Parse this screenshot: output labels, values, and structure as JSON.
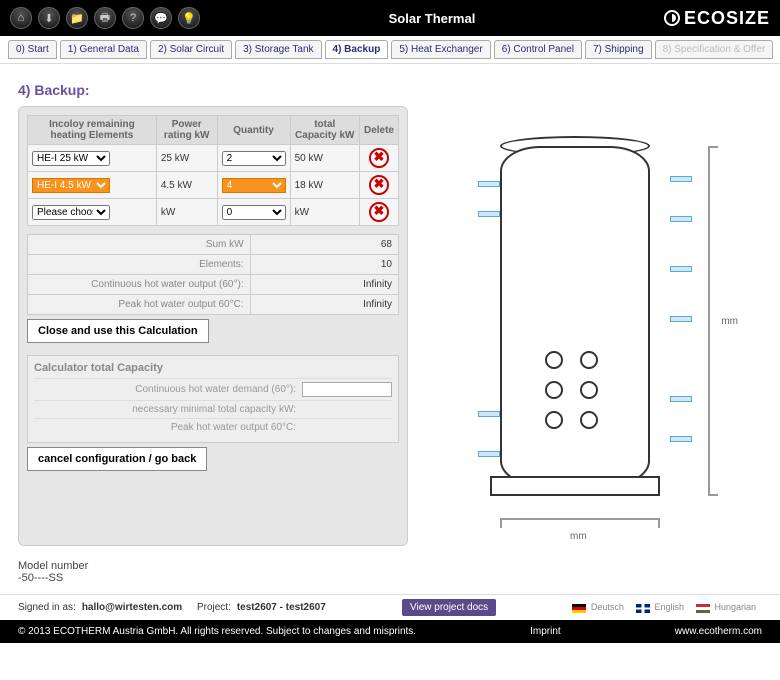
{
  "topbar": {
    "title": "Solar Thermal",
    "brand": "ECOSIZE"
  },
  "icons": [
    "home",
    "download",
    "folder",
    "print",
    "help",
    "chat",
    "lightbulb"
  ],
  "tabs": [
    {
      "label": "0) Start"
    },
    {
      "label": "1) General Data"
    },
    {
      "label": "2) Solar Circuit"
    },
    {
      "label": "3) Storage Tank"
    },
    {
      "label": "4) Backup",
      "current": true
    },
    {
      "label": "5) Heat Exchanger"
    },
    {
      "label": "6) Control Panel"
    },
    {
      "label": "7) Shipping"
    },
    {
      "label": "8) Specification & Offer",
      "disabled": true
    }
  ],
  "section_title": "4) Backup:",
  "table": {
    "headers": {
      "elements": "Incoloy remaining heating Elements",
      "power": "Power rating kW",
      "qty": "Quantity",
      "total": "total Capacity kW",
      "delete": "Delete"
    },
    "rows": [
      {
        "elem": "HE-I 25 kW",
        "power": "25 kW",
        "qty": "2",
        "total": "50 kW"
      },
      {
        "elem": "HE-I 4.5 kW",
        "power": "4.5 kW",
        "qty": "4",
        "total": "18 kW",
        "highlight": true
      },
      {
        "elem": "Please choose",
        "power": "kW",
        "qty": "0",
        "total": "kW"
      }
    ]
  },
  "summary": {
    "sum_kw_label": "Sum kW",
    "sum_kw_value": "68",
    "elements_label": "Elements:",
    "elements_value": "10",
    "cont_label": "Continuous hot water output (60°):",
    "cont_value": "Infinity",
    "peak_label": "Peak hot water output 60°C:",
    "peak_value": "Infinity"
  },
  "close_btn": "Close and use this Calculation",
  "calc": {
    "title": "Calculator total Capacity",
    "row1": "Continuous hot water demand (60°):",
    "row2": "necessary minimal total capacity kW:",
    "row3": "Peak hot water output 60°C:"
  },
  "cancel_btn": "cancel configuration / go back",
  "dims": {
    "v": "mm",
    "h": "mm"
  },
  "model": {
    "label": "Model number",
    "value": "-50----SS"
  },
  "status": {
    "signed_prefix": "Signed in as: ",
    "signed_user": "hallo@wirtesten.com",
    "project_prefix": "Project: ",
    "project_name": "test2607 - test2607",
    "view_docs": "View project docs",
    "lang_de": "Deutsch",
    "lang_en": "English",
    "lang_hu": "Hungarian"
  },
  "footer": {
    "copyright": "© 2013 ECOTHERM Austria GmbH. All rights reserved. Subject to changes and misprints.",
    "imprint": "Imprint",
    "site": "www.ecotherm.com"
  }
}
